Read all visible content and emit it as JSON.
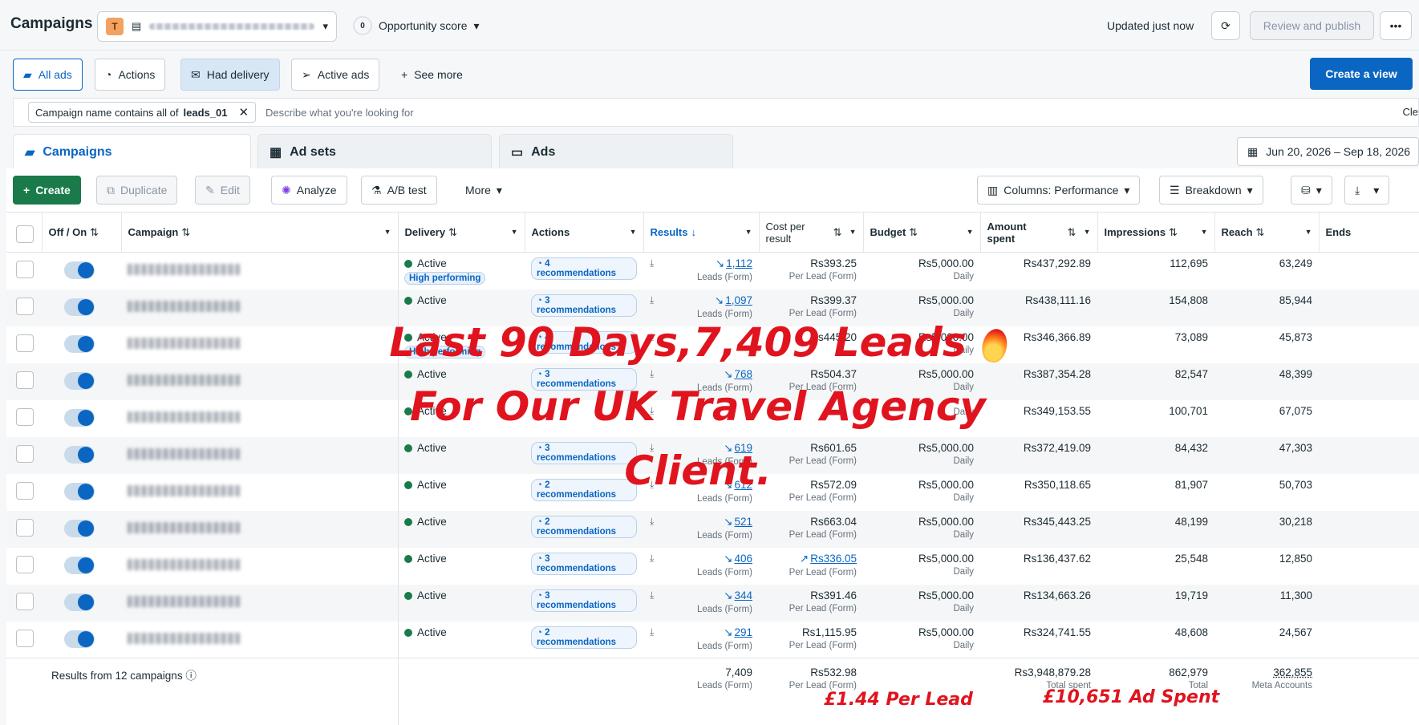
{
  "header": {
    "title": "Campaigns",
    "account_badge": "T",
    "opportunity_score_value": "0",
    "opportunity_score_label": "Opportunity score",
    "updated_text": "Updated just now",
    "review_publish_label": "Review and publish"
  },
  "views": {
    "items": [
      {
        "label": "All ads"
      },
      {
        "label": "Actions"
      },
      {
        "label": "Had delivery"
      },
      {
        "label": "Active ads"
      },
      {
        "label": "See more"
      }
    ],
    "create_view_label": "Create a view"
  },
  "filter": {
    "chip_prefix": "Campaign name contains all of",
    "chip_value": "leads_01",
    "placeholder": "Describe what you're looking for",
    "clear_label": "Cle"
  },
  "tabs": [
    {
      "label": "Campaigns"
    },
    {
      "label": "Ad sets"
    },
    {
      "label": "Ads"
    }
  ],
  "date_range": "Jun 20, 2026 – Sep 18, 2026",
  "toolbar": {
    "create": "Create",
    "duplicate": "Duplicate",
    "edit": "Edit",
    "analyze": "Analyze",
    "ab_test": "A/B test",
    "more": "More",
    "columns": "Columns: Performance",
    "breakdown": "Breakdown"
  },
  "table": {
    "headers": {
      "off_on": "Off / On",
      "campaign": "Campaign",
      "delivery": "Delivery",
      "actions": "Actions",
      "results": "Results",
      "cost_per_result": "Cost per result",
      "budget": "Budget",
      "amount_spent": "Amount spent",
      "impressions": "Impressions",
      "reach": "Reach",
      "ends": "Ends"
    },
    "rows": [
      {
        "delivery": "Active",
        "badge": "High performing",
        "recs": "4 recommendations",
        "results": "1,112",
        "results_sub": "Leads (Form)",
        "cost": "Rs393.25",
        "cost_sub": "Per Lead (Form)",
        "budget": "Rs5,000.00",
        "budget_sub": "Daily",
        "spent": "Rs437,292.89",
        "impressions": "112,695",
        "reach": "63,249"
      },
      {
        "delivery": "Active",
        "badge": "",
        "recs": "3 recommendations",
        "results": "1,097",
        "results_sub": "Leads (Form)",
        "cost": "Rs399.37",
        "cost_sub": "Per Lead (Form)",
        "budget": "Rs5,000.00",
        "budget_sub": "Daily",
        "spent": "Rs438,111.16",
        "impressions": "154,808",
        "reach": "85,944"
      },
      {
        "delivery": "Active",
        "badge": "High performing",
        "recs": "4 recommendations",
        "results": "",
        "results_sub": "",
        "cost": "Rs445.20",
        "cost_sub": "",
        "budget": "Rs5,000.00",
        "budget_sub": "Daily",
        "spent": "Rs346,366.89",
        "impressions": "73,089",
        "reach": "45,873"
      },
      {
        "delivery": "Active",
        "badge": "",
        "recs": "3 recommendations",
        "results": "768",
        "results_sub": "Leads (Form)",
        "cost": "Rs504.37",
        "cost_sub": "Per Lead (Form)",
        "budget": "Rs5,000.00",
        "budget_sub": "Daily",
        "spent": "Rs387,354.28",
        "impressions": "82,547",
        "reach": "48,399"
      },
      {
        "delivery": "Active",
        "badge": "",
        "recs": "",
        "results": "",
        "results_sub": "",
        "cost": "",
        "cost_sub": "",
        "budget": "",
        "budget_sub": "Daily",
        "spent": "Rs349,153.55",
        "impressions": "100,701",
        "reach": "67,075"
      },
      {
        "delivery": "Active",
        "badge": "",
        "recs": "3 recommendations",
        "results": "619",
        "results_sub": "Leads (Form)",
        "cost": "Rs601.65",
        "cost_sub": "Per Lead (Form)",
        "budget": "Rs5,000.00",
        "budget_sub": "Daily",
        "spent": "Rs372,419.09",
        "impressions": "84,432",
        "reach": "47,303"
      },
      {
        "delivery": "Active",
        "badge": "",
        "recs": "2 recommendations",
        "results": "612",
        "results_sub": "Leads (Form)",
        "cost": "Rs572.09",
        "cost_sub": "Per Lead (Form)",
        "budget": "Rs5,000.00",
        "budget_sub": "Daily",
        "spent": "Rs350,118.65",
        "impressions": "81,907",
        "reach": "50,703"
      },
      {
        "delivery": "Active",
        "badge": "",
        "recs": "2 recommendations",
        "results": "521",
        "results_sub": "Leads (Form)",
        "cost": "Rs663.04",
        "cost_sub": "Per Lead (Form)",
        "budget": "Rs5,000.00",
        "budget_sub": "Daily",
        "spent": "Rs345,443.25",
        "impressions": "48,199",
        "reach": "30,218"
      },
      {
        "delivery": "Active",
        "badge": "",
        "recs": "3 recommendations",
        "results": "406",
        "results_sub": "Leads (Form)",
        "cost": "Rs336.05",
        "cost_sub": "Per Lead (Form)",
        "budget": "Rs5,000.00",
        "budget_sub": "Daily",
        "spent": "Rs136,437.62",
        "impressions": "25,548",
        "reach": "12,850"
      },
      {
        "delivery": "Active",
        "badge": "",
        "recs": "3 recommendations",
        "results": "344",
        "results_sub": "Leads (Form)",
        "cost": "Rs391.46",
        "cost_sub": "Per Lead (Form)",
        "budget": "Rs5,000.00",
        "budget_sub": "Daily",
        "spent": "Rs134,663.26",
        "impressions": "19,719",
        "reach": "11,300"
      },
      {
        "delivery": "Active",
        "badge": "",
        "recs": "2 recommendations",
        "results": "291",
        "results_sub": "Leads (Form)",
        "cost": "Rs1,115.95",
        "cost_sub": "Per Lead (Form)",
        "budget": "Rs5,000.00",
        "budget_sub": "Daily",
        "spent": "Rs324,741.55",
        "impressions": "48,608",
        "reach": "24,567"
      }
    ],
    "footer": {
      "label": "Results from 12 campaigns",
      "results": "7,409",
      "results_sub": "Leads (Form)",
      "cost": "Rs532.98",
      "cost_sub": "Per Lead (Form)",
      "spent": "Rs3,948,879.28",
      "spent_sub": "Total spent",
      "impressions": "862,979",
      "impressions_sub": "Total",
      "reach": "362,855",
      "reach_sub": "Meta Accounts"
    }
  },
  "overlay": {
    "line1": "Last 90 Days,7,409 Leads",
    "line2": "For Our UK Travel Agency",
    "line3": "Client.",
    "cost_per_lead": "£1.44 Per Lead",
    "ad_spent": "£10,651 Ad Spent"
  },
  "colors": {
    "accent": "#0a66c2",
    "create_green": "#1a7a4a",
    "overlay_red": "#e0141e"
  }
}
